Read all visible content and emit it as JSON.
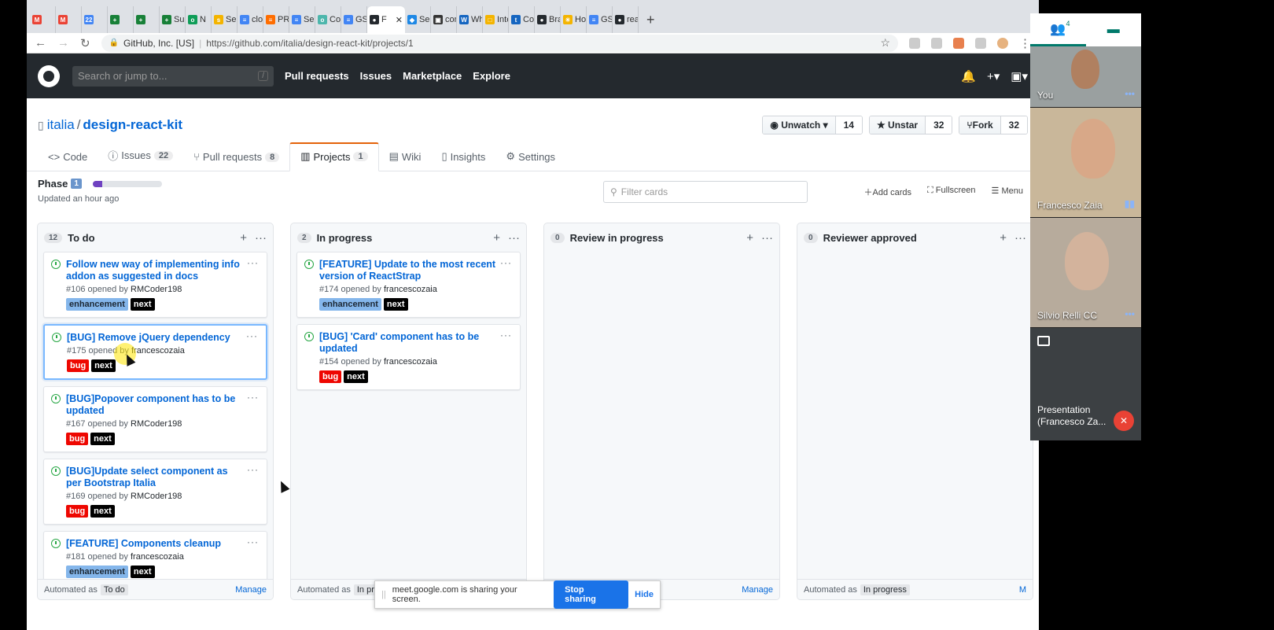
{
  "browser": {
    "tabs": [
      {
        "label": "",
        "fav": "M",
        "color": "#ea4335"
      },
      {
        "label": "",
        "fav": "M",
        "color": "#ea4335"
      },
      {
        "label": "",
        "fav": "22",
        "color": "#4285f4"
      },
      {
        "label": "",
        "fav": "+",
        "color": "#188038"
      },
      {
        "label": "",
        "fav": "+",
        "color": "#188038"
      },
      {
        "label": "Sug",
        "fav": "+",
        "color": "#188038"
      },
      {
        "label": "N",
        "fav": "o",
        "color": "#0f9d58"
      },
      {
        "label": "Serv",
        "fav": "s",
        "color": "#f4b400"
      },
      {
        "label": "clou",
        "fav": "≡",
        "color": "#4285f4"
      },
      {
        "label": "PRC",
        "fav": "≡",
        "color": "#ff6d00"
      },
      {
        "label": "Serv",
        "fav": "≡",
        "color": "#4285f4"
      },
      {
        "label": "Con",
        "fav": "o",
        "color": "#4db6ac"
      },
      {
        "label": "GSo",
        "fav": "≡",
        "color": "#4285f4"
      },
      {
        "label": "F",
        "fav": "●",
        "color": "#24292e",
        "active": true
      },
      {
        "label": "Secu",
        "fav": "◆",
        "color": "#1e88e5"
      },
      {
        "label": "cont",
        "fav": "▣",
        "color": "#333"
      },
      {
        "label": "Wha",
        "fav": "W",
        "color": "#1565c0"
      },
      {
        "label": "Inte",
        "fav": "□",
        "color": "#f4b400"
      },
      {
        "label": "Con",
        "fav": "t",
        "color": "#1565c0"
      },
      {
        "label": "Bran",
        "fav": "●",
        "color": "#24292e"
      },
      {
        "label": "How",
        "fav": "☀",
        "color": "#f4b400"
      },
      {
        "label": "GSo",
        "fav": "≡",
        "color": "#4285f4"
      },
      {
        "label": "reac",
        "fav": "●",
        "color": "#24292e"
      }
    ],
    "site_label": "GitHub, Inc. [US]",
    "url": "https://github.com/italia/design-react-kit/projects/1"
  },
  "github": {
    "search_placeholder": "Search or jump to...",
    "search_shortcut": "/",
    "nav": [
      "Pull requests",
      "Issues",
      "Marketplace",
      "Explore"
    ],
    "repo_owner": "italia",
    "repo_name": "design-react-kit",
    "watch": {
      "label": "Unwatch",
      "count": "14"
    },
    "star": {
      "label": "Unstar",
      "count": "32"
    },
    "fork": {
      "label": "Fork",
      "count": "32"
    },
    "tabs": [
      {
        "label": "Code",
        "icon": "<>",
        "counter": ""
      },
      {
        "label": "Issues",
        "icon": "ⓘ",
        "counter": "22"
      },
      {
        "label": "Pull requests",
        "icon": "⑂",
        "counter": "8"
      },
      {
        "label": "Projects",
        "icon": "▥",
        "counter": "1",
        "selected": true
      },
      {
        "label": "Wiki",
        "icon": "▤",
        "counter": ""
      },
      {
        "label": "Insights",
        "icon": "▯",
        "counter": ""
      },
      {
        "label": "Settings",
        "icon": "⚙",
        "counter": ""
      }
    ]
  },
  "project": {
    "name": "Phase",
    "number": "1",
    "progress_fraction": 0.14,
    "updated": "Updated an hour ago",
    "filter_placeholder": "Filter cards",
    "tools": [
      "Add cards",
      "Fullscreen",
      "Menu"
    ]
  },
  "columns": [
    {
      "name": "To do",
      "count": "12",
      "footer_prefix": "Automated as",
      "footer_mode": "To do",
      "manage": "Manage",
      "cards": [
        {
          "title": "Follow new way of implementing info addon as suggested in docs",
          "number": "#106",
          "opened_by": "opened by",
          "user": "RMCoder198",
          "labels": [
            "enhancement",
            "next"
          ]
        },
        {
          "title": "[BUG] Remove jQuery dependency",
          "number": "#175",
          "opened_by": "opened by",
          "user": "francescozaia",
          "labels": [
            "bug",
            "next"
          ],
          "focus": true
        },
        {
          "title": "[BUG]Popover component has to be updated",
          "number": "#167",
          "opened_by": "opened by",
          "user": "RMCoder198",
          "labels": [
            "bug",
            "next"
          ]
        },
        {
          "title": "[BUG]Update select component as per Bootstrap Italia",
          "number": "#169",
          "opened_by": "opened by",
          "user": "RMCoder198",
          "labels": [
            "bug",
            "next"
          ]
        },
        {
          "title": "[FEATURE] Components cleanup",
          "number": "#181",
          "opened_by": "opened by",
          "user": "francescozaia",
          "labels": [
            "enhancement",
            "next"
          ]
        }
      ]
    },
    {
      "name": "In progress",
      "count": "2",
      "footer_prefix": "Automated as",
      "footer_mode": "In pro",
      "manage": "",
      "cards": [
        {
          "title": "[FEATURE] Update to the most recent version of ReactStrap",
          "number": "#174",
          "opened_by": "opened by",
          "user": "francescozaia",
          "labels": [
            "enhancement",
            "next"
          ]
        },
        {
          "title": "[BUG] 'Card' component has to be updated",
          "number": "#154",
          "opened_by": "opened by",
          "user": "francescozaia",
          "labels": [
            "bug",
            "next"
          ]
        }
      ]
    },
    {
      "name": "Review in progress",
      "count": "0",
      "footer_prefix": "",
      "footer_mode": "",
      "manage": "Manage",
      "cards": []
    },
    {
      "name": "Reviewer approved",
      "count": "0",
      "footer_prefix": "Automated as",
      "footer_mode": "In progress",
      "manage": "M",
      "cards": []
    }
  ],
  "label_styles": {
    "enhancement": {
      "bg": "#84b6eb",
      "fg": "#1c2733"
    },
    "bug": {
      "bg": "#ee0701",
      "fg": "#ffffff"
    },
    "next": {
      "bg": "#000000",
      "fg": "#ffffff"
    }
  },
  "share_banner": {
    "text": "meet.google.com is sharing your screen.",
    "stop": "Stop sharing",
    "hide": "Hide"
  },
  "meet": {
    "participant_count": "4",
    "participants": [
      {
        "name": "You"
      },
      {
        "name": "Francesco Zaia"
      },
      {
        "name": "Silvio Relli CC"
      }
    ],
    "presentation": "Presentation (Francesco Za..."
  }
}
